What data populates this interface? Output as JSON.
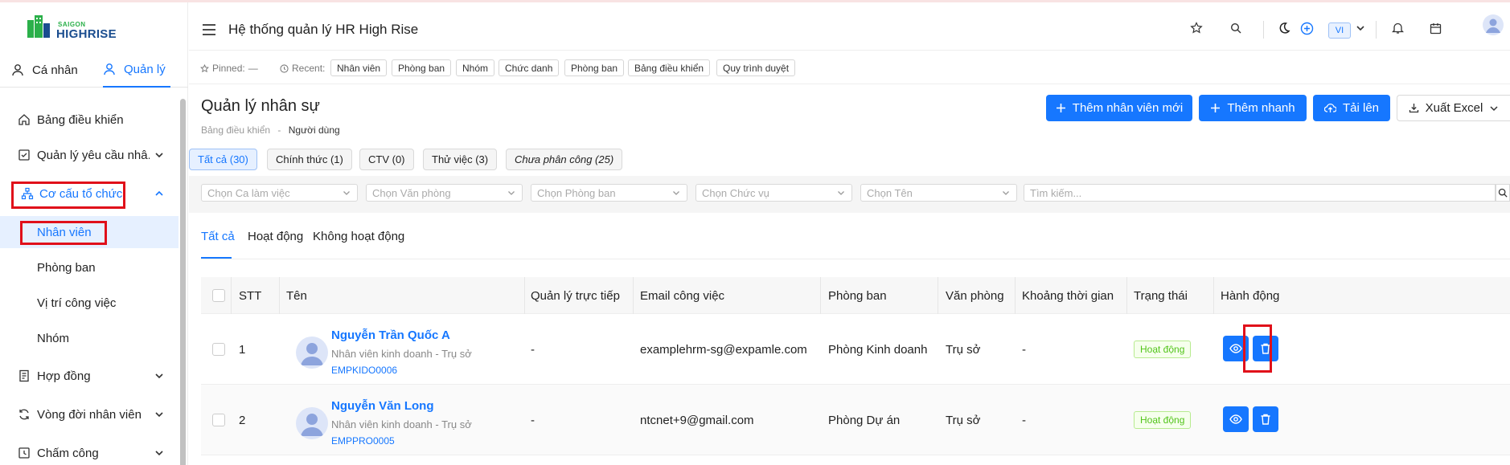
{
  "colors": {
    "accent": "#1677ff",
    "highlight": "#e0101a",
    "success": "#52c41a"
  },
  "logo": {
    "line1": "SAIGON",
    "line2": "HIGHRISE"
  },
  "mode_tabs": [
    {
      "label": "Cá nhân",
      "icon": "user-icon"
    },
    {
      "label": "Quản lý",
      "icon": "user-icon"
    }
  ],
  "sidebar": {
    "items": [
      {
        "label": "Bảng điều khiển",
        "icon": "home-icon"
      },
      {
        "label": "Quản lý yêu cầu nhâ...",
        "icon": "checkbox-icon"
      },
      {
        "label": "Cơ cấu tổ chức",
        "icon": "org-chart-icon"
      },
      {
        "label": "Hợp đồng",
        "icon": "contract-icon"
      },
      {
        "label": "Vòng đời nhân viên",
        "icon": "cycle-icon"
      },
      {
        "label": "Chấm công",
        "icon": "clock-icon"
      }
    ],
    "sub_items": [
      "Nhân viên",
      "Phòng ban",
      "Vị trí công việc",
      "Nhóm"
    ]
  },
  "header": {
    "title": "Hệ thống quản lý HR High Rise",
    "lang": "VI"
  },
  "pinbar": {
    "pinned_label": "Pinned:",
    "pinned_value": "—",
    "recent_label": "Recent:",
    "recent": [
      "Nhân viên",
      "Phòng ban",
      "Nhóm",
      "Chức danh",
      "Phòng ban",
      "Bảng điều khiển",
      "Quy trình duyệt"
    ]
  },
  "page": {
    "title": "Quản lý nhân sự",
    "breadcrumb_root": "Bảng điều khiển",
    "breadcrumb_sep": "-",
    "breadcrumb_current": "Người dùng",
    "buttons": {
      "add_employee": "Thêm nhân viên mới",
      "quick_add": "Thêm nhanh",
      "upload": "Tải lên",
      "export": "Xuất Excel"
    }
  },
  "segments": [
    "Tất cả (30)",
    "Chính thức (1)",
    "CTV (0)",
    "Thử việc (3)",
    "Chưa phân công (25)"
  ],
  "filters": {
    "shift": "Chọn Ca làm việc",
    "office": "Chọn Văn phòng",
    "department": "Chọn Phòng ban",
    "position": "Chọn Chức vụ",
    "name": "Chọn Tên",
    "search_placeholder": "Tìm kiếm..."
  },
  "tabs": [
    "Tất cả",
    "Hoạt động",
    "Không hoạt động"
  ],
  "table": {
    "columns": [
      "STT",
      "Tên",
      "Quản lý trực tiếp",
      "Email công việc",
      "Phòng ban",
      "Văn phòng",
      "Khoảng thời gian",
      "Trạng thái",
      "Hành động"
    ],
    "rows": [
      {
        "stt": "1",
        "name": "Nguyễn Trần Quốc A",
        "role": "Nhân viên kinh doanh - Trụ sở",
        "code": "EMPKIDO0006",
        "manager": "-",
        "email": "examplehrm-sg@expamle.com",
        "department": "Phòng Kinh doanh",
        "office": "Trụ sở",
        "period": "-",
        "status": "Hoạt động"
      },
      {
        "stt": "2",
        "name": "Nguyễn Văn Long",
        "role": "Nhân viên kinh doanh - Trụ sở",
        "code": "EMPPRO0005",
        "manager": "-",
        "email": "ntcnet+9@gmail.com",
        "department": "Phòng Dự án",
        "office": "Trụ sở",
        "period": "-",
        "status": "Hoạt động"
      }
    ]
  }
}
